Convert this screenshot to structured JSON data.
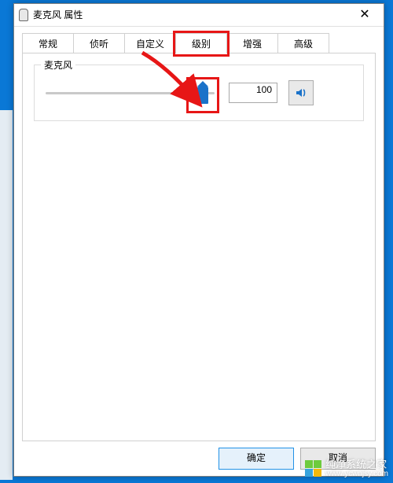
{
  "window": {
    "title": "麦克风 属性",
    "close_label": "✕"
  },
  "tabs": {
    "general": "常规",
    "listen": "侦听",
    "custom": "自定义",
    "level": "级别",
    "enhance": "增强",
    "advanced": "高级",
    "active_index": 3
  },
  "level_tab": {
    "group_label": "麦克风",
    "slider_value": "100",
    "speaker_icon": "speaker-icon"
  },
  "buttons": {
    "ok": "确定",
    "cancel": "取消"
  },
  "watermark": {
    "name": "纯净系统之家",
    "url": "www.ycwnjsy.com"
  },
  "annotations": {
    "highlight_tab": "level",
    "highlight_thumb": true,
    "arrow_from_tab_to_thumb": true
  }
}
